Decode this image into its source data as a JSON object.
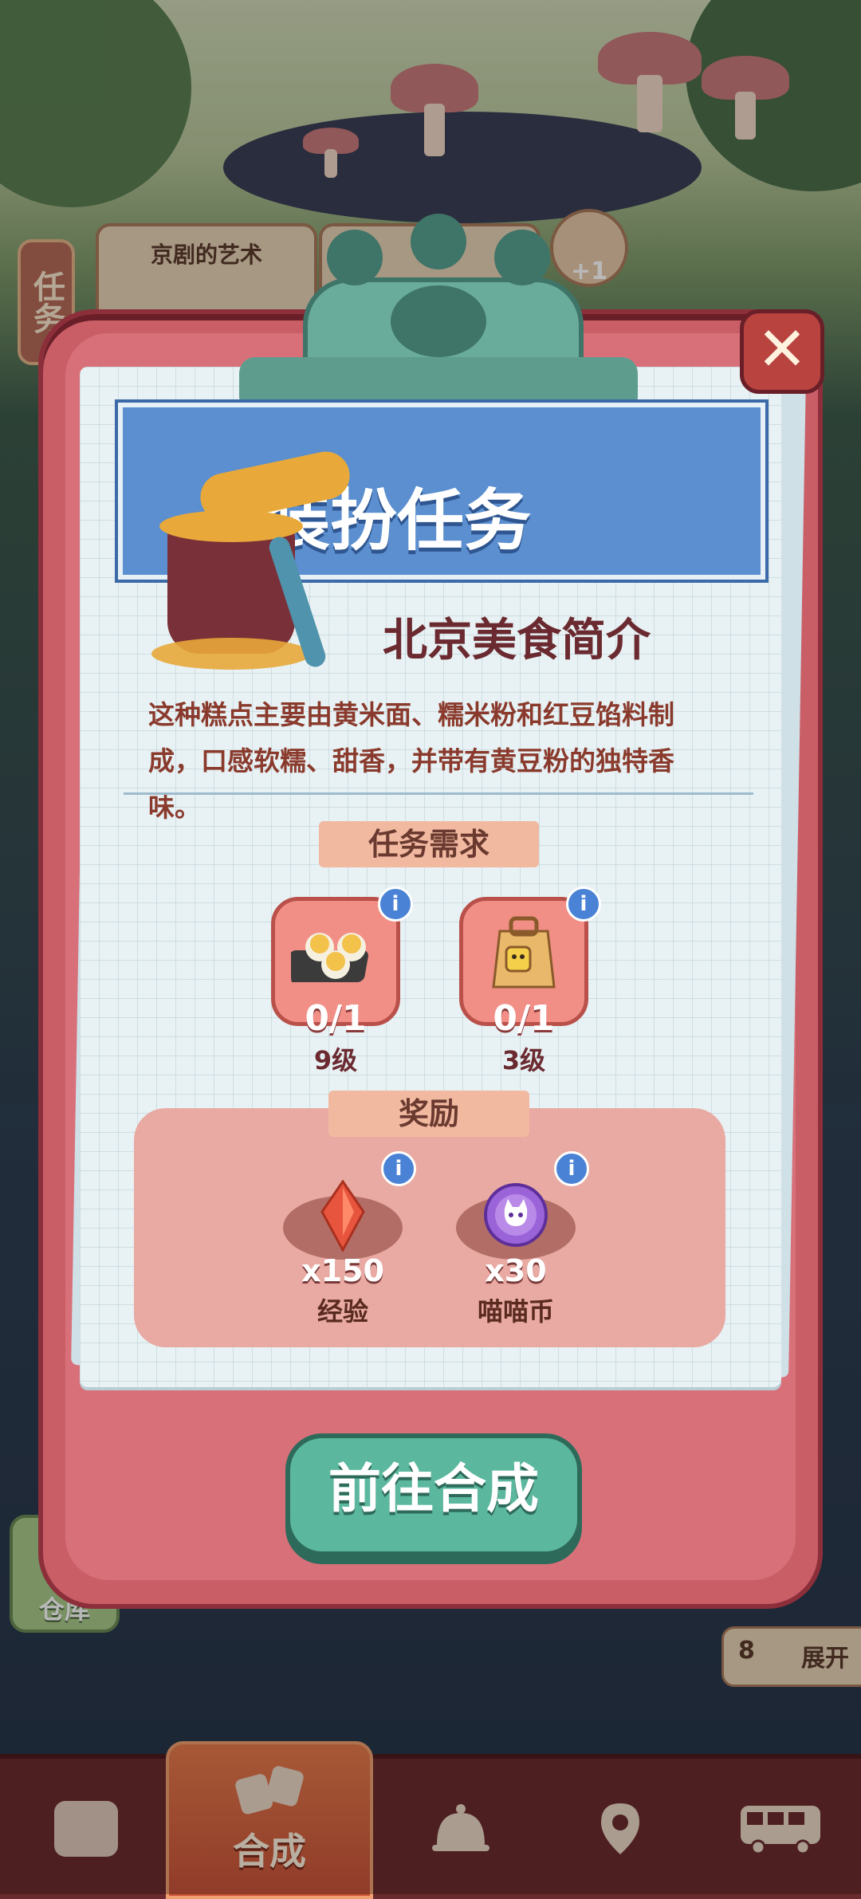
{
  "background": {
    "task_tab_label": "任务",
    "top_cards": [
      "京剧的艺术"
    ],
    "top_badge": "+1",
    "store_label": "仓库",
    "expand_count": "8",
    "expand_label": "展开"
  },
  "bottom_nav": {
    "items": [
      {
        "name": "shop",
        "icon": "bag-icon"
      },
      {
        "name": "merge",
        "label": "合成",
        "icon": "merge-icon",
        "active": true
      },
      {
        "name": "service",
        "icon": "bell-icon"
      },
      {
        "name": "map",
        "icon": "map-pin-icon"
      },
      {
        "name": "bus",
        "icon": "bus-icon"
      }
    ]
  },
  "modal": {
    "close_icon": "close-icon",
    "banner_title": "装扮任务",
    "subtitle": "北京美食简介",
    "description": "这种糕点主要由黄米面、糯米粉和红豆馅料制成，口感软糯、甜香，并带有黄豆粉的独特香味。",
    "requirements_title": "任务需求",
    "requirements": [
      {
        "count": "0/1",
        "level": "9级",
        "icon": "pudding-tray-icon"
      },
      {
        "count": "0/1",
        "level": "3级",
        "icon": "takeout-box-icon"
      }
    ],
    "rewards_title": "奖励",
    "rewards": [
      {
        "amount": "x150",
        "label": "经验",
        "icon": "crystal-icon",
        "color": "#e8553f"
      },
      {
        "amount": "x30",
        "label": "喵喵币",
        "icon": "cat-coin-icon",
        "color": "#9a63d8"
      }
    ],
    "action_button": "前往合成"
  }
}
